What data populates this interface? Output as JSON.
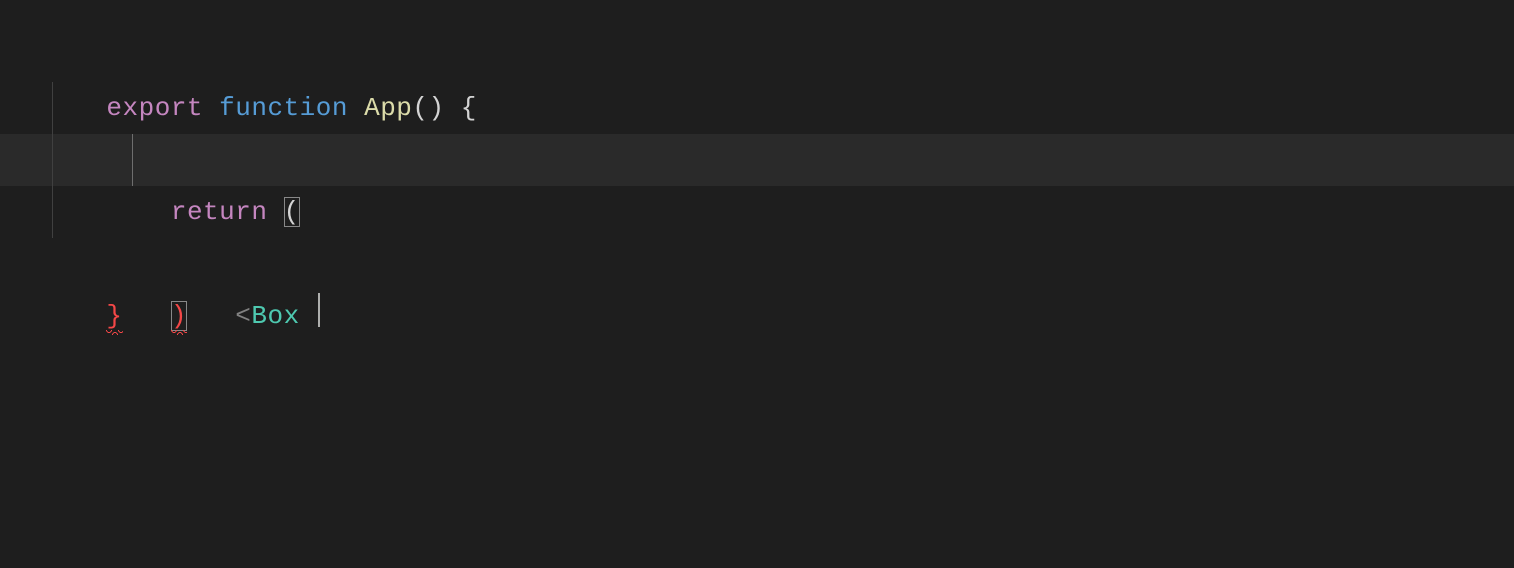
{
  "editor": {
    "theme": "dark-plus",
    "language": "jsx",
    "active_line_index": 2,
    "tokens": {
      "l1": {
        "export": "export",
        "space1": " ",
        "function": "function",
        "space2": " ",
        "fn_name": "App",
        "parens": "()",
        "space3": " ",
        "brace_open": "{"
      },
      "l2": {
        "indent": "    ",
        "return": "return",
        "space": " ",
        "paren_open": "("
      },
      "l3": {
        "indent": "        ",
        "lt": "<",
        "tag": "Box",
        "tail": " "
      },
      "l4": {
        "indent": "    ",
        "paren_close": ")"
      },
      "l5": {
        "brace_close": "}"
      }
    }
  }
}
